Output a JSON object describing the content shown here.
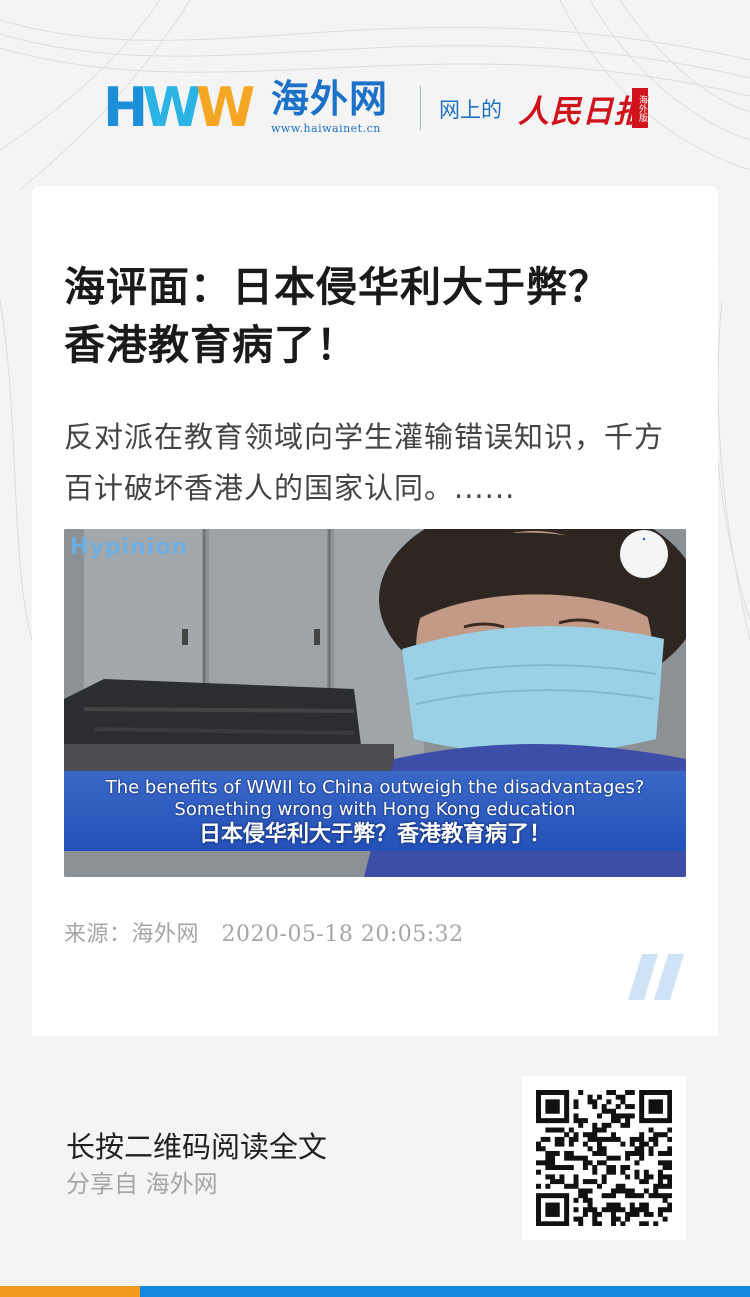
{
  "header": {
    "logo_letters": [
      "H",
      "W",
      "W"
    ],
    "site_name": "海外网",
    "site_url": "www.haiwainet.cn",
    "tagline": "网上的",
    "paper_name": "人民日报",
    "paper_badge": "海外版",
    "brand_colors": {
      "blue": "#1b72c8",
      "light_blue": "#2bb3e6",
      "orange": "#f5a623",
      "red": "#d0121b"
    }
  },
  "article": {
    "title": "海评面：日本侵华利大于弊？香港教育病了！",
    "summary": "反对派在教育领域向学生灌输错误知识，千方百计破坏香港人的国家认同。......",
    "image": {
      "watermark": "Hypinion",
      "caption_en_line1": "The benefits of WWII to China outweigh the disadvantages?",
      "caption_en_line2": "Something wrong with Hong Kong education",
      "caption_zh": "日本侵华利大于弊？香港教育病了！"
    },
    "source_label": "来源：",
    "source_name": "海外网",
    "timestamp": "2020-05-18 20:05:32"
  },
  "footer": {
    "cta": "长按二维码阅读全文",
    "shared_from": "分享自 海外网",
    "qr_icon": "qr-code-icon",
    "bar_colors": {
      "left": "#f39a1e",
      "right": "#1287de"
    }
  }
}
